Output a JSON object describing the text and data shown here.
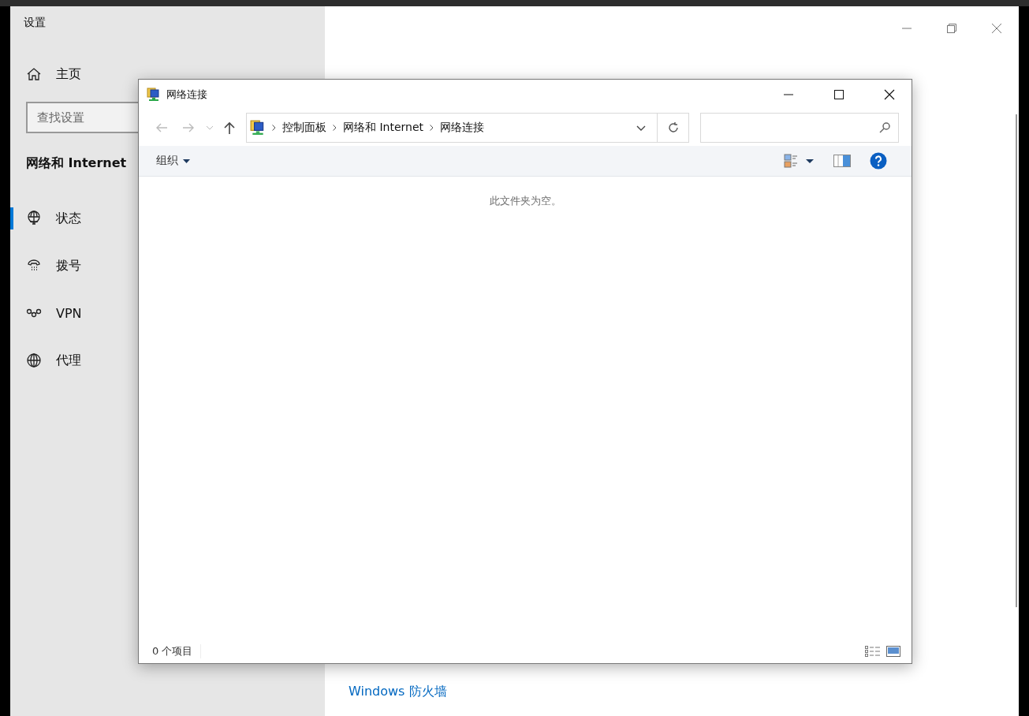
{
  "settings": {
    "title": "设置",
    "home": "主页",
    "search_placeholder": "查找设置",
    "section": "网络和 Internet",
    "nav": [
      {
        "kind": "status",
        "label": "状态",
        "selected": true
      },
      {
        "kind": "dialup",
        "label": "拨号",
        "selected": false
      },
      {
        "kind": "vpn",
        "label": "VPN",
        "selected": false
      },
      {
        "kind": "proxy",
        "label": "代理",
        "selected": false
      }
    ],
    "link": "Windows 防火墙"
  },
  "explorer": {
    "title": "网络连接",
    "breadcrumb": [
      "控制面板",
      "网络和 Internet",
      "网络连接"
    ],
    "organize": "组织",
    "empty_message": "此文件夹为空。",
    "item_count": "0 个项目"
  }
}
